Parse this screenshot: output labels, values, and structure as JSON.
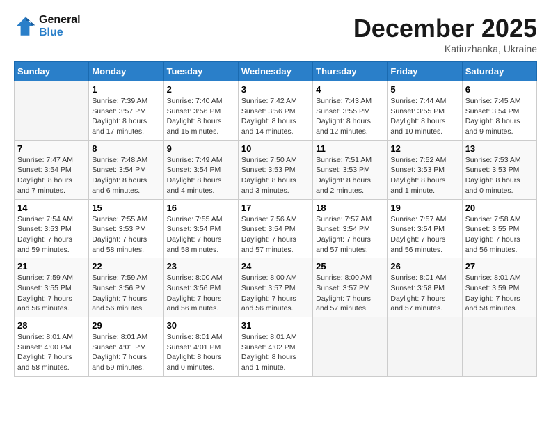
{
  "header": {
    "logo_line1": "General",
    "logo_line2": "Blue",
    "month": "December 2025",
    "location": "Katiuzhanka, Ukraine"
  },
  "weekdays": [
    "Sunday",
    "Monday",
    "Tuesday",
    "Wednesday",
    "Thursday",
    "Friday",
    "Saturday"
  ],
  "weeks": [
    [
      {
        "day": "",
        "sunrise": "",
        "sunset": "",
        "daylight": ""
      },
      {
        "day": "1",
        "sunrise": "Sunrise: 7:39 AM",
        "sunset": "Sunset: 3:57 PM",
        "daylight": "Daylight: 8 hours and 17 minutes."
      },
      {
        "day": "2",
        "sunrise": "Sunrise: 7:40 AM",
        "sunset": "Sunset: 3:56 PM",
        "daylight": "Daylight: 8 hours and 15 minutes."
      },
      {
        "day": "3",
        "sunrise": "Sunrise: 7:42 AM",
        "sunset": "Sunset: 3:56 PM",
        "daylight": "Daylight: 8 hours and 14 minutes."
      },
      {
        "day": "4",
        "sunrise": "Sunrise: 7:43 AM",
        "sunset": "Sunset: 3:55 PM",
        "daylight": "Daylight: 8 hours and 12 minutes."
      },
      {
        "day": "5",
        "sunrise": "Sunrise: 7:44 AM",
        "sunset": "Sunset: 3:55 PM",
        "daylight": "Daylight: 8 hours and 10 minutes."
      },
      {
        "day": "6",
        "sunrise": "Sunrise: 7:45 AM",
        "sunset": "Sunset: 3:54 PM",
        "daylight": "Daylight: 8 hours and 9 minutes."
      }
    ],
    [
      {
        "day": "7",
        "sunrise": "Sunrise: 7:47 AM",
        "sunset": "Sunset: 3:54 PM",
        "daylight": "Daylight: 8 hours and 7 minutes."
      },
      {
        "day": "8",
        "sunrise": "Sunrise: 7:48 AM",
        "sunset": "Sunset: 3:54 PM",
        "daylight": "Daylight: 8 hours and 6 minutes."
      },
      {
        "day": "9",
        "sunrise": "Sunrise: 7:49 AM",
        "sunset": "Sunset: 3:54 PM",
        "daylight": "Daylight: 8 hours and 4 minutes."
      },
      {
        "day": "10",
        "sunrise": "Sunrise: 7:50 AM",
        "sunset": "Sunset: 3:53 PM",
        "daylight": "Daylight: 8 hours and 3 minutes."
      },
      {
        "day": "11",
        "sunrise": "Sunrise: 7:51 AM",
        "sunset": "Sunset: 3:53 PM",
        "daylight": "Daylight: 8 hours and 2 minutes."
      },
      {
        "day": "12",
        "sunrise": "Sunrise: 7:52 AM",
        "sunset": "Sunset: 3:53 PM",
        "daylight": "Daylight: 8 hours and 1 minute."
      },
      {
        "day": "13",
        "sunrise": "Sunrise: 7:53 AM",
        "sunset": "Sunset: 3:53 PM",
        "daylight": "Daylight: 8 hours and 0 minutes."
      }
    ],
    [
      {
        "day": "14",
        "sunrise": "Sunrise: 7:54 AM",
        "sunset": "Sunset: 3:53 PM",
        "daylight": "Daylight: 7 hours and 59 minutes."
      },
      {
        "day": "15",
        "sunrise": "Sunrise: 7:55 AM",
        "sunset": "Sunset: 3:53 PM",
        "daylight": "Daylight: 7 hours and 58 minutes."
      },
      {
        "day": "16",
        "sunrise": "Sunrise: 7:55 AM",
        "sunset": "Sunset: 3:54 PM",
        "daylight": "Daylight: 7 hours and 58 minutes."
      },
      {
        "day": "17",
        "sunrise": "Sunrise: 7:56 AM",
        "sunset": "Sunset: 3:54 PM",
        "daylight": "Daylight: 7 hours and 57 minutes."
      },
      {
        "day": "18",
        "sunrise": "Sunrise: 7:57 AM",
        "sunset": "Sunset: 3:54 PM",
        "daylight": "Daylight: 7 hours and 57 minutes."
      },
      {
        "day": "19",
        "sunrise": "Sunrise: 7:57 AM",
        "sunset": "Sunset: 3:54 PM",
        "daylight": "Daylight: 7 hours and 56 minutes."
      },
      {
        "day": "20",
        "sunrise": "Sunrise: 7:58 AM",
        "sunset": "Sunset: 3:55 PM",
        "daylight": "Daylight: 7 hours and 56 minutes."
      }
    ],
    [
      {
        "day": "21",
        "sunrise": "Sunrise: 7:59 AM",
        "sunset": "Sunset: 3:55 PM",
        "daylight": "Daylight: 7 hours and 56 minutes."
      },
      {
        "day": "22",
        "sunrise": "Sunrise: 7:59 AM",
        "sunset": "Sunset: 3:56 PM",
        "daylight": "Daylight: 7 hours and 56 minutes."
      },
      {
        "day": "23",
        "sunrise": "Sunrise: 8:00 AM",
        "sunset": "Sunset: 3:56 PM",
        "daylight": "Daylight: 7 hours and 56 minutes."
      },
      {
        "day": "24",
        "sunrise": "Sunrise: 8:00 AM",
        "sunset": "Sunset: 3:57 PM",
        "daylight": "Daylight: 7 hours and 56 minutes."
      },
      {
        "day": "25",
        "sunrise": "Sunrise: 8:00 AM",
        "sunset": "Sunset: 3:57 PM",
        "daylight": "Daylight: 7 hours and 57 minutes."
      },
      {
        "day": "26",
        "sunrise": "Sunrise: 8:01 AM",
        "sunset": "Sunset: 3:58 PM",
        "daylight": "Daylight: 7 hours and 57 minutes."
      },
      {
        "day": "27",
        "sunrise": "Sunrise: 8:01 AM",
        "sunset": "Sunset: 3:59 PM",
        "daylight": "Daylight: 7 hours and 58 minutes."
      }
    ],
    [
      {
        "day": "28",
        "sunrise": "Sunrise: 8:01 AM",
        "sunset": "Sunset: 4:00 PM",
        "daylight": "Daylight: 7 hours and 58 minutes."
      },
      {
        "day": "29",
        "sunrise": "Sunrise: 8:01 AM",
        "sunset": "Sunset: 4:01 PM",
        "daylight": "Daylight: 7 hours and 59 minutes."
      },
      {
        "day": "30",
        "sunrise": "Sunrise: 8:01 AM",
        "sunset": "Sunset: 4:01 PM",
        "daylight": "Daylight: 8 hours and 0 minutes."
      },
      {
        "day": "31",
        "sunrise": "Sunrise: 8:01 AM",
        "sunset": "Sunset: 4:02 PM",
        "daylight": "Daylight: 8 hours and 1 minute."
      },
      {
        "day": "",
        "sunrise": "",
        "sunset": "",
        "daylight": ""
      },
      {
        "day": "",
        "sunrise": "",
        "sunset": "",
        "daylight": ""
      },
      {
        "day": "",
        "sunrise": "",
        "sunset": "",
        "daylight": ""
      }
    ]
  ]
}
